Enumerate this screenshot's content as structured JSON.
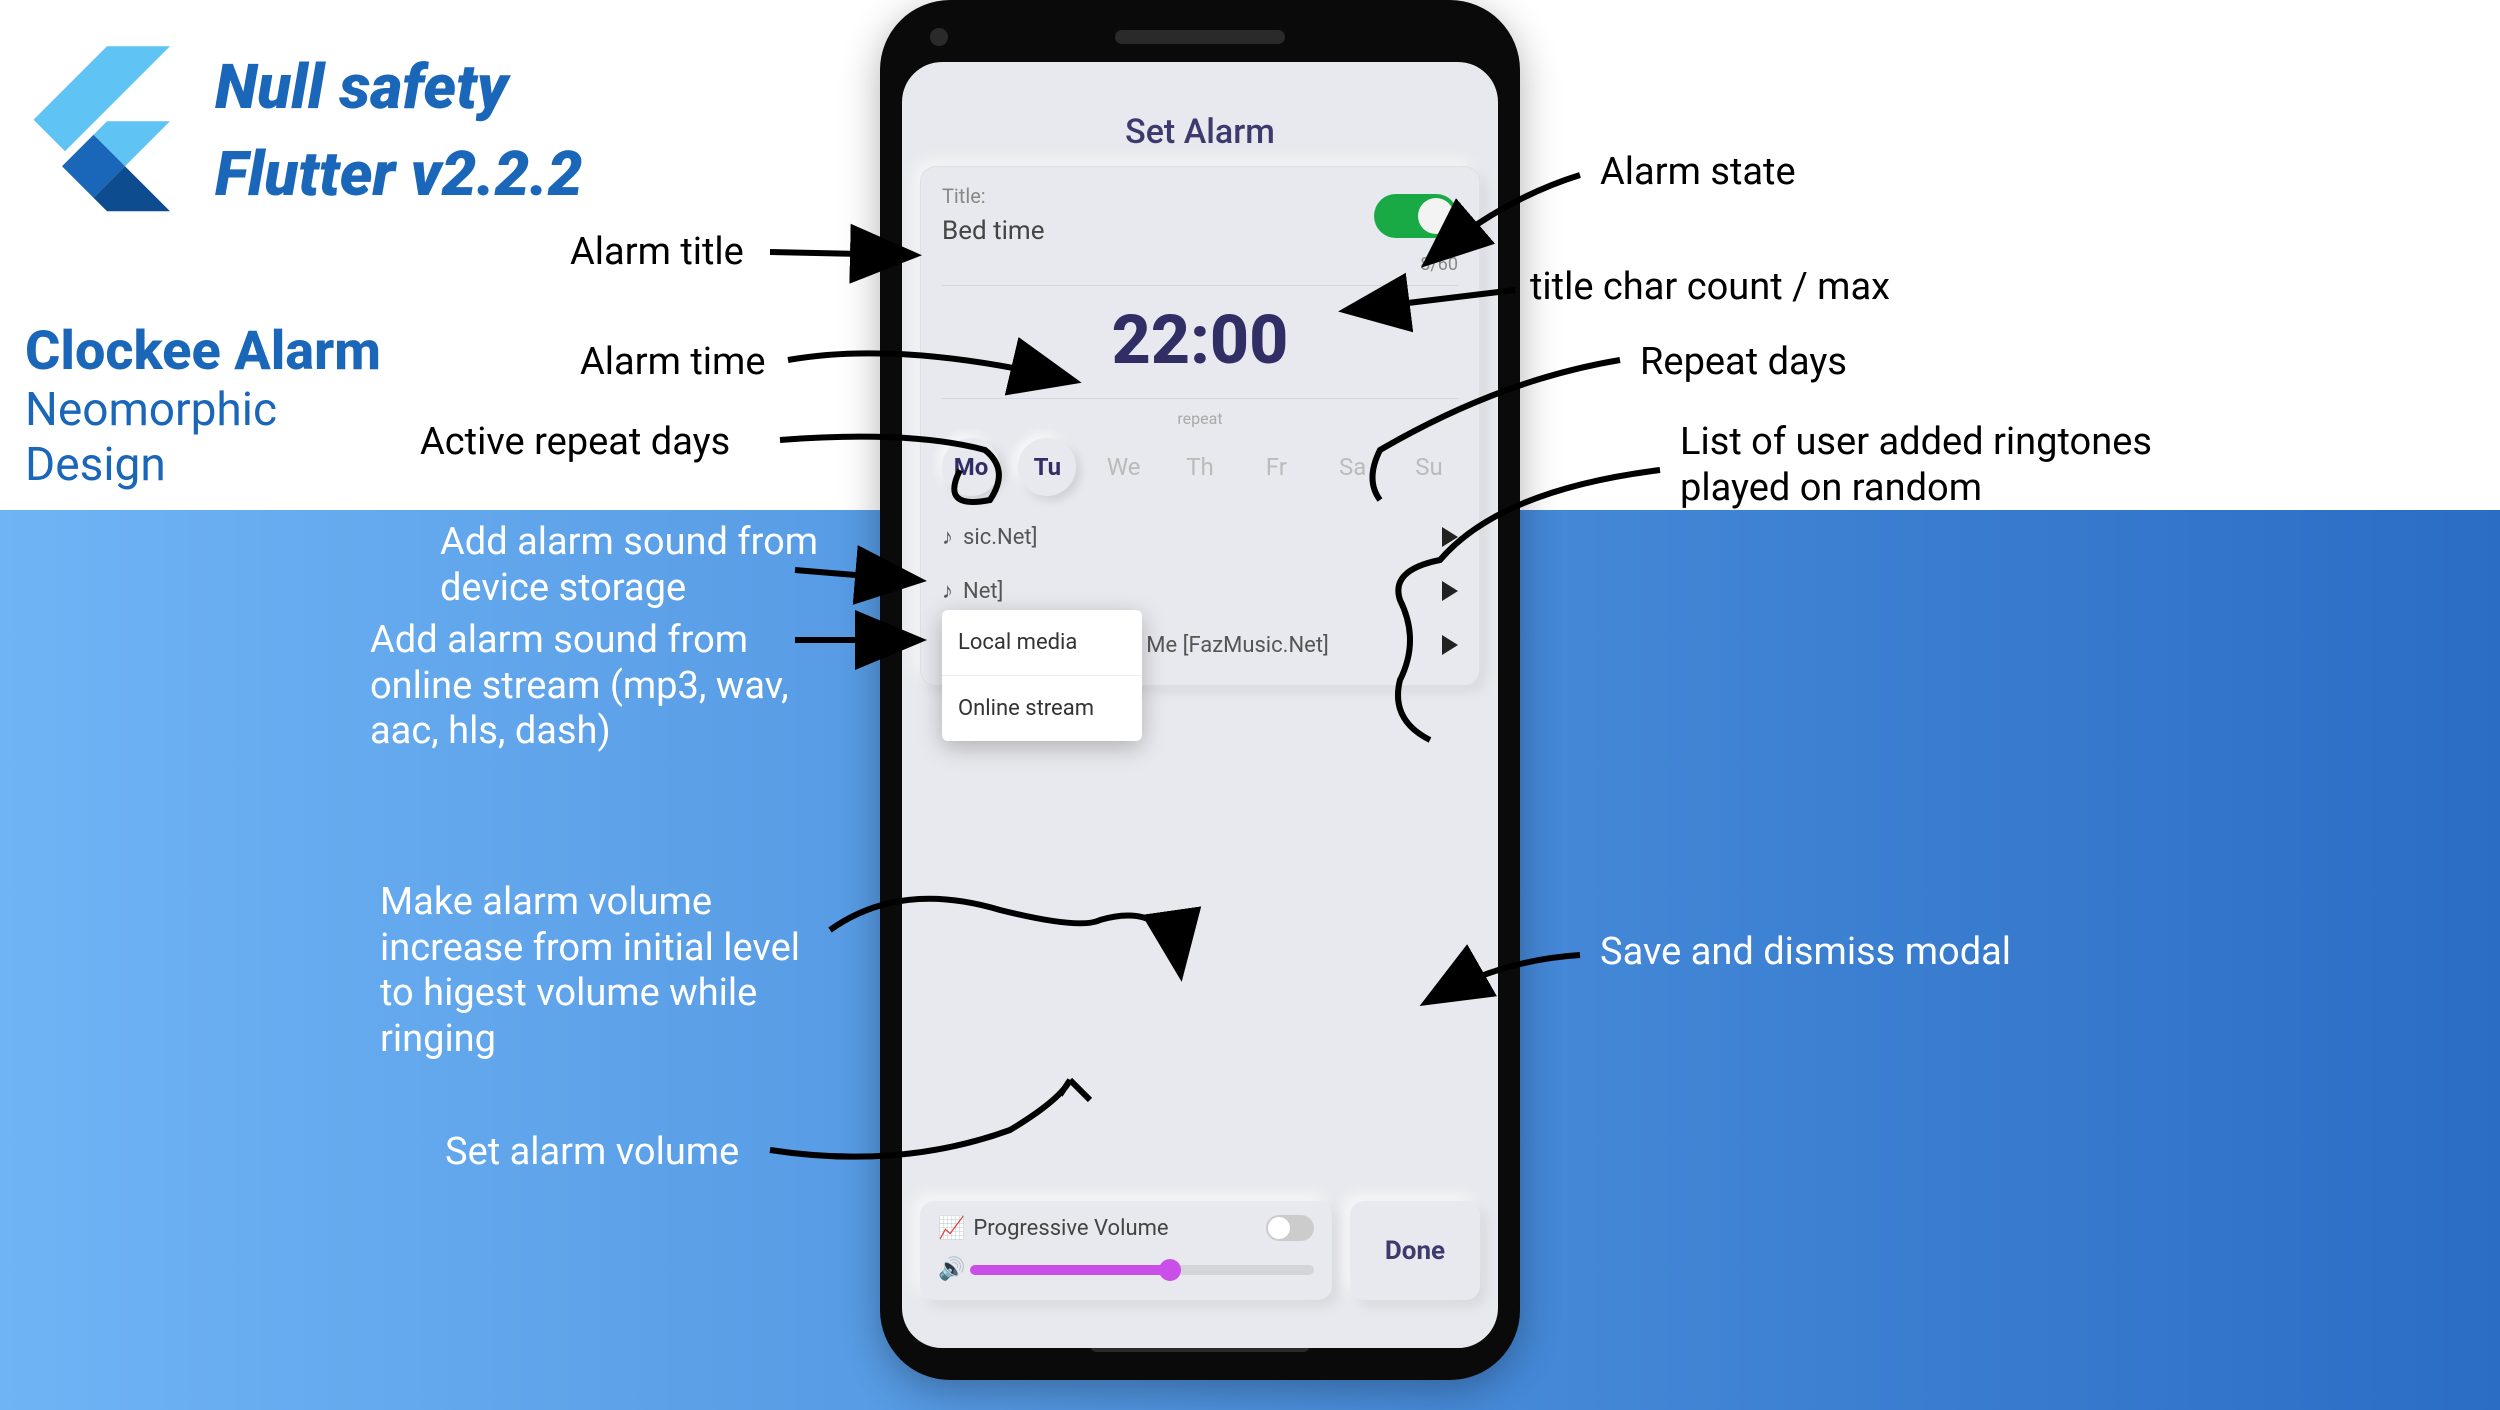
{
  "headline": {
    "line1": "Null safety",
    "line2": "Flutter v2.2.2"
  },
  "subhead": {
    "title": "Clockee Alarm",
    "desc1": "Neomorphic",
    "desc2": "Design"
  },
  "annotations": {
    "alarm_title": "Alarm title",
    "alarm_time": "Alarm time",
    "active_repeat_days": "Active repeat days",
    "add_local": "Add alarm sound from device storage",
    "add_online": "Add alarm sound from online stream (mp3, wav, aac, hls, dash)",
    "progressive": "Make alarm volume increase from initial level to higest volume while ringing",
    "set_volume": "Set alarm volume",
    "alarm_state": "Alarm state",
    "char_count": "title char count / max",
    "repeat_days": "Repeat days",
    "ringtones_list": "List of user added ringtones played on random",
    "save_dismiss": "Save and dismiss modal"
  },
  "screen": {
    "title": "Set Alarm",
    "alarm": {
      "title_label": "Title:",
      "title_value": "Bed time",
      "enabled": true,
      "char_count": "8/60",
      "time": "22:00",
      "repeat_label": "repeat",
      "days": [
        {
          "abbr": "Mo",
          "active": true
        },
        {
          "abbr": "Tu",
          "active": true
        },
        {
          "abbr": "We",
          "active": false
        },
        {
          "abbr": "Th",
          "active": false
        },
        {
          "abbr": "Fr",
          "active": false
        },
        {
          "abbr": "Sa",
          "active": false
        },
        {
          "abbr": "Su",
          "active": false
        }
      ]
    },
    "popup": {
      "local": "Local media",
      "online": "Online stream"
    },
    "ringtones": [
      "sic.Net]",
      "Net]",
      "Find Yourself With Me [FazMusic.Net]"
    ],
    "volume": {
      "progressive_label": "Progressive Volume",
      "progressive_on": false,
      "percent": 58
    },
    "done_label": "Done"
  }
}
